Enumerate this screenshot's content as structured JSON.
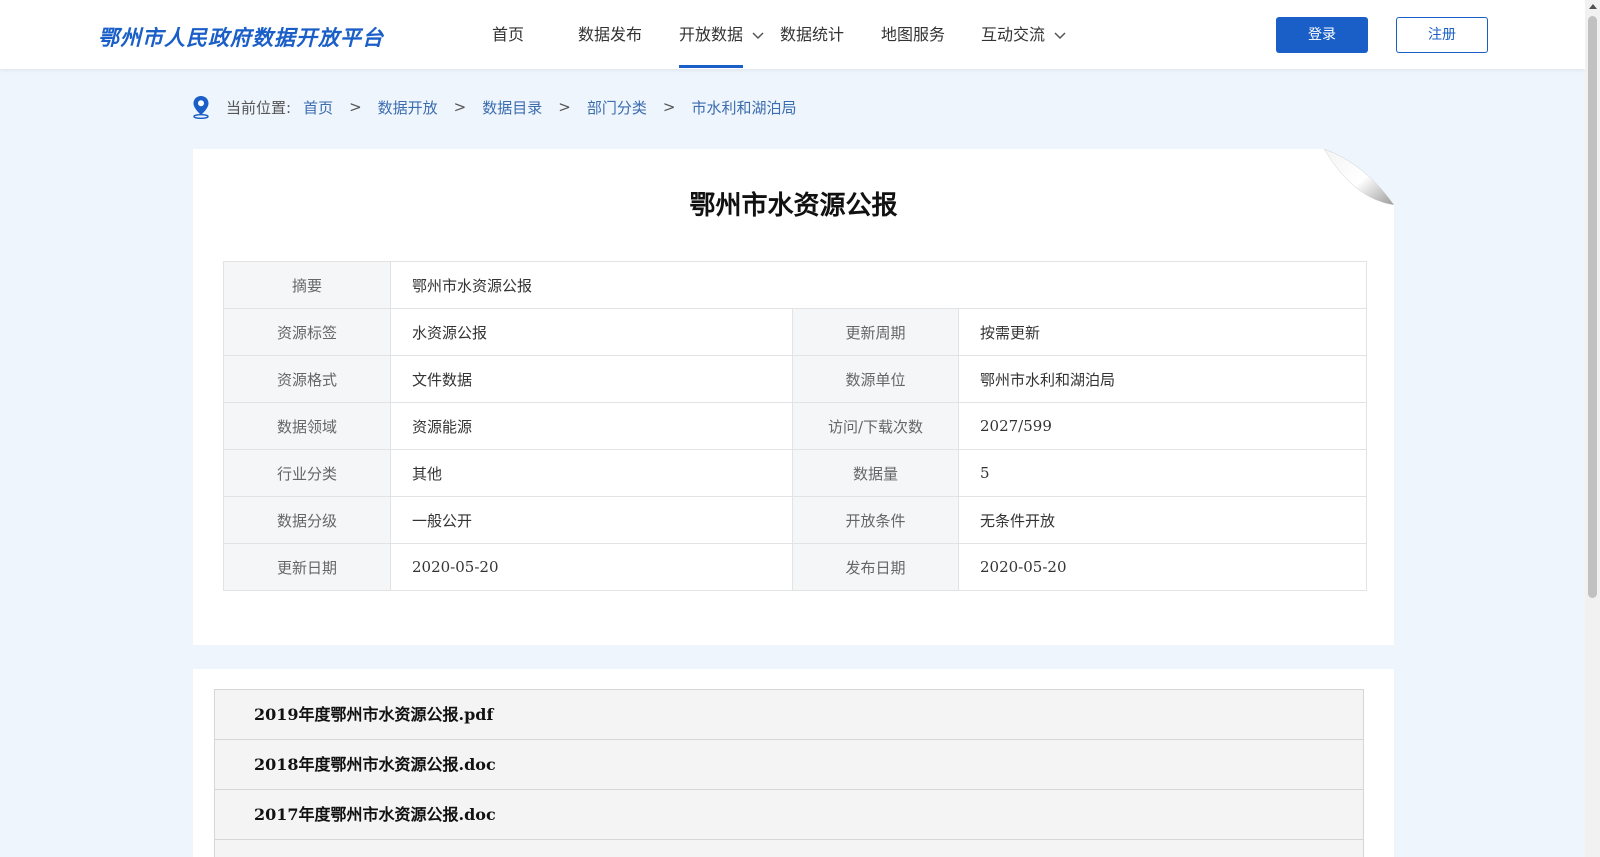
{
  "header": {
    "logo_text": "鄂州市人民政府数据开放平台",
    "nav": [
      {
        "label": "首页"
      },
      {
        "label": "数据发布"
      },
      {
        "label": "开放数据",
        "active": true,
        "has_dropdown": true
      },
      {
        "label": "数据统计"
      },
      {
        "label": "地图服务"
      },
      {
        "label": "互动交流",
        "has_dropdown": true
      }
    ],
    "login_label": "登录",
    "register_label": "注册",
    "accent_color": "#1a5fc8"
  },
  "breadcrumb": {
    "prefix": "当前位置:",
    "items": [
      "首页",
      "数据开放",
      "数据目录",
      "部门分类",
      "市水利和湖泊局"
    ],
    "separator": ">"
  },
  "detail": {
    "title": "鄂州市水资源公报",
    "summary_label": "摘要",
    "summary_value": "鄂州市水资源公报",
    "rows": [
      {
        "k1": "资源标签",
        "v1": "水资源公报",
        "k2": "更新周期",
        "v2": "按需更新"
      },
      {
        "k1": "资源格式",
        "v1": "文件数据",
        "k2": "数源单位",
        "v2": "鄂州市水利和湖泊局"
      },
      {
        "k1": "数据领域",
        "v1": "资源能源",
        "k2": "访问/下载次数",
        "v2": "2027/599"
      },
      {
        "k1": "行业分类",
        "v1": "其他",
        "k2": "数据量",
        "v2": "5"
      },
      {
        "k1": "数据分级",
        "v1": "一般公开",
        "k2": "开放条件",
        "v2": "无条件开放"
      },
      {
        "k1": "更新日期",
        "v1": "2020-05-20",
        "k2": "发布日期",
        "v2": "2020-05-20"
      }
    ]
  },
  "files": [
    "2019年度鄂州市水资源公报.pdf",
    "2018年度鄂州市水资源公报.doc",
    "2017年度鄂州市水资源公报.doc",
    ""
  ]
}
